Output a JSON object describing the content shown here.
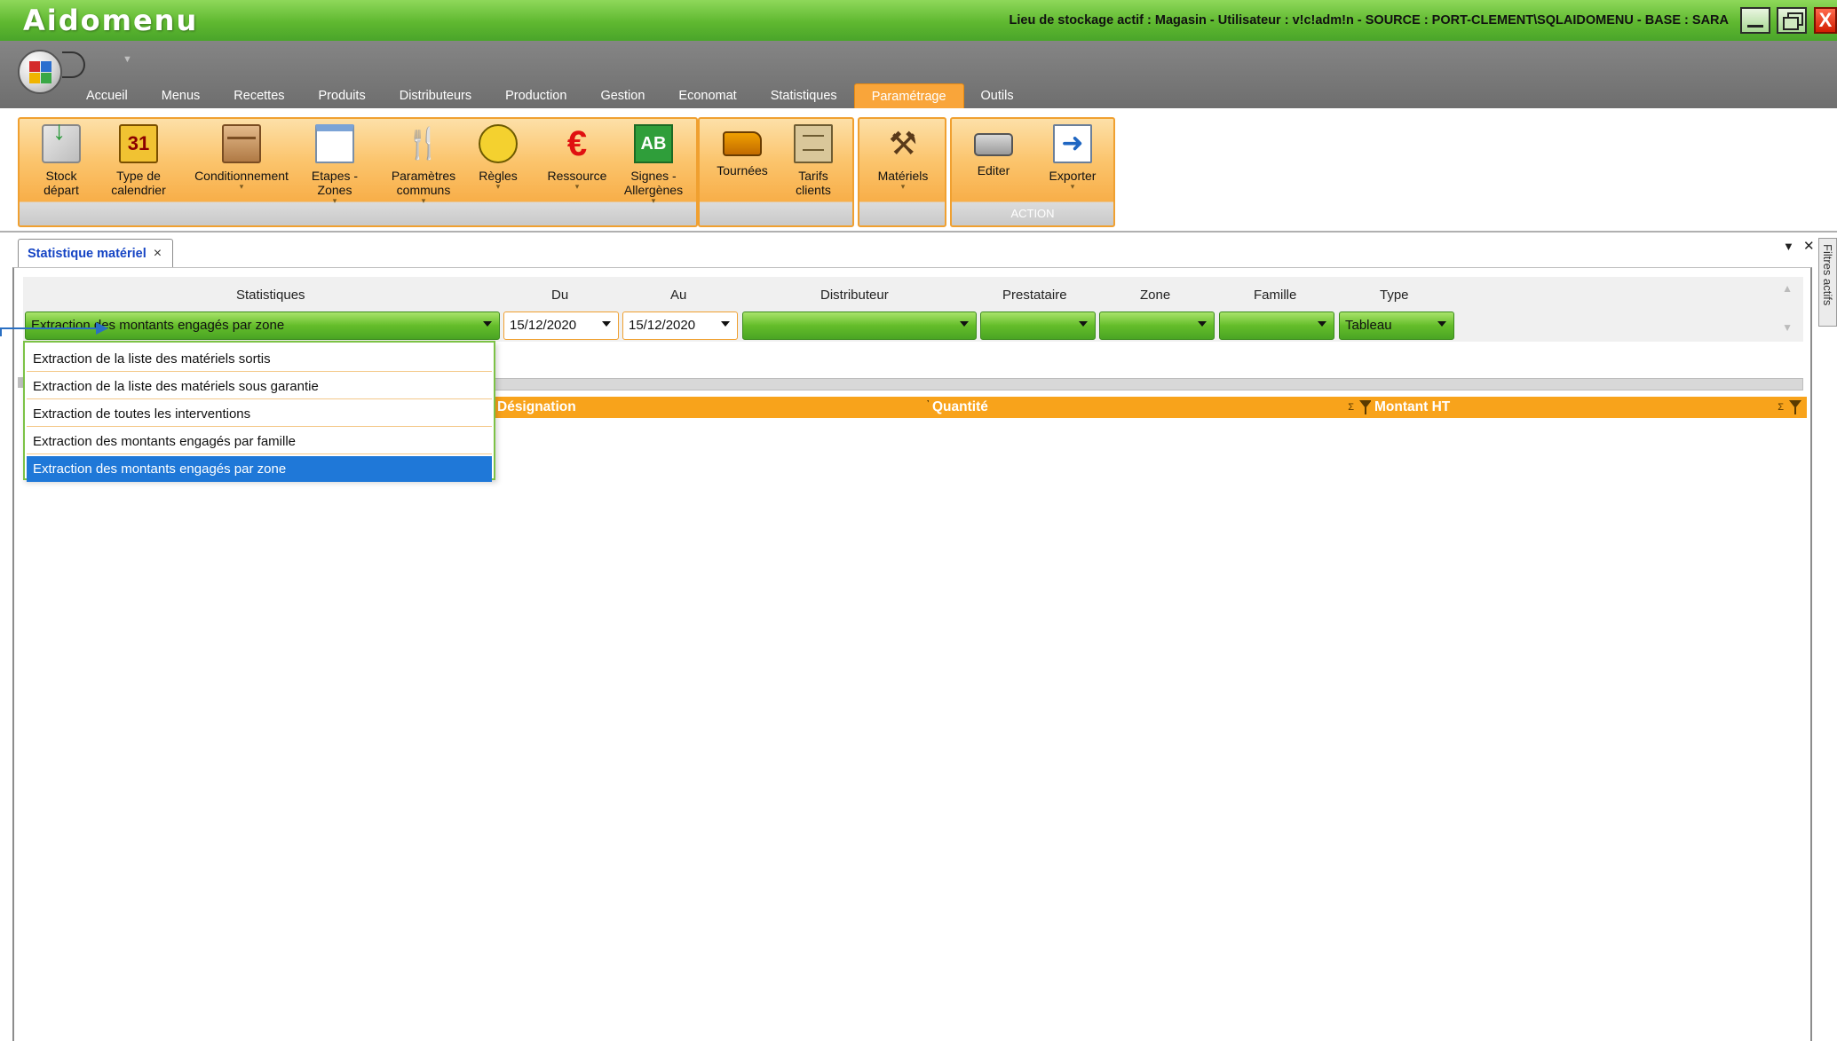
{
  "window": {
    "app_title": "Aidomenu",
    "status_info": "Lieu de stockage actif : Magasin - Utilisateur : v!c!adm!n - SOURCE : PORT-CLEMENT\\SQLAIDOMENU - BASE : SARA",
    "close_glyph": "X"
  },
  "menu": {
    "tabs": [
      "Accueil",
      "Menus",
      "Recettes",
      "Produits",
      "Distributeurs",
      "Production",
      "Gestion",
      "Economat",
      "Statistiques",
      "Paramétrage",
      "Outils"
    ],
    "active_tab": "Paramétrage"
  },
  "ribbon": {
    "calendar_day": "31",
    "ab_label": "AB",
    "group_main": [
      {
        "line1": "Stock",
        "line2": "départ",
        "icon": "stock-icon"
      },
      {
        "line1": "Type de",
        "line2": "calendrier",
        "icon": "calendar-icon"
      },
      {
        "line1": "Conditionnement",
        "line2": "",
        "icon": "box-icon",
        "dropdown": true
      },
      {
        "line1": "Etapes -",
        "line2": "Zones",
        "icon": "window-icon",
        "dropdown": true
      },
      {
        "line1": "Paramètres",
        "line2": "communs",
        "icon": "cutlery-icon",
        "dropdown": true
      },
      {
        "line1": "Règles",
        "line2": "",
        "icon": "rules-icon",
        "dropdown": true
      },
      {
        "line1": "Ressource",
        "line2": "",
        "icon": "euro-icon",
        "dropdown": true
      },
      {
        "line1": "Signes -",
        "line2": "Allergènes",
        "icon": "organic-icon",
        "dropdown": true
      }
    ],
    "group_delivery": [
      {
        "line1": "Tournées",
        "line2": "",
        "icon": "truck-icon"
      },
      {
        "line1": "Tarifs",
        "line2": "clients",
        "icon": "price-list-icon"
      }
    ],
    "group_materials": [
      {
        "line1": "Matériels",
        "line2": "",
        "icon": "tools-icon",
        "dropdown": true
      }
    ],
    "group_action": {
      "caption": "ACTION",
      "buttons": [
        {
          "line1": "Editer",
          "line2": "",
          "icon": "printer-icon"
        },
        {
          "line1": "Exporter",
          "line2": "",
          "icon": "export-icon",
          "dropdown": true
        }
      ]
    }
  },
  "document_tab": {
    "title": "Statistique matériel",
    "close_glyph": "×"
  },
  "side_panel": {
    "label": "Filtres actifs"
  },
  "filters": {
    "labels": {
      "statistiques": "Statistiques",
      "du": "Du",
      "au": "Au",
      "distributeur": "Distributeur",
      "prestataire": "Prestataire",
      "zone": "Zone",
      "famille": "Famille",
      "type": "Type"
    },
    "statistiques_value": "Extraction des montants engagés par zone",
    "du_value": "15/12/2020",
    "au_value": "15/12/2020",
    "distributeur_value": "",
    "prestataire_value": "",
    "zone_value": "",
    "famille_value": "",
    "type_value": "Tableau"
  },
  "statistiques_options": [
    "Extraction de la liste des matériels sortis",
    "Extraction de la liste des matériels sous garantie",
    "Extraction de toutes les interventions",
    "Extraction des montants engagés par famille",
    "Extraction des montants engagés par zone"
  ],
  "selected_option_index": 4,
  "grid": {
    "columns": [
      "Désignation",
      "Quantité",
      "Montant HT"
    ],
    "sigma": "Σ"
  },
  "colors": {
    "title_green": "#5fb830",
    "ribbon_orange": "#f8ae48",
    "header_orange": "#f8a31b",
    "selected_blue": "#1f78d8",
    "tab_title_blue": "#1544c4"
  }
}
